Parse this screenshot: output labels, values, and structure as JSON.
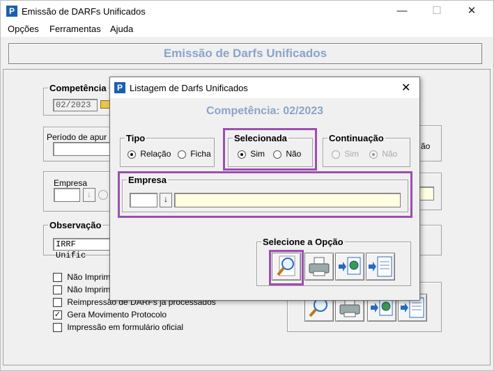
{
  "window": {
    "title": "Emissão de DARFs Unificados",
    "minimize": "—",
    "maximize": "☐",
    "close": "✕"
  },
  "menu": [
    "Opções",
    "Ferramentas",
    "Ajuda"
  ],
  "banner": "Emissão de Darfs Unificados",
  "main": {
    "competencia_label": "Competência",
    "competencia_value": "02/2023",
    "periodo_label": "Período de apur",
    "empresa_label": "Empresa",
    "observacao_label": "Observação",
    "observacao_value": "IRRF Unific",
    "right_fragment": "ão",
    "checks": [
      {
        "label": "Não Imprim",
        "checked": false
      },
      {
        "label": "Não Imprim",
        "checked": false
      },
      {
        "label": "Reimpressão de DARFs já processados",
        "checked": false
      },
      {
        "label": "Gera Movimento Protocolo",
        "checked": true
      },
      {
        "label": "Impressão em formulário oficial",
        "checked": false
      }
    ]
  },
  "dialog": {
    "title": "Listagem de Darfs Unificados",
    "close": "✕",
    "competencia": "Competência: 02/2023",
    "tipo": {
      "label": "Tipo",
      "opt1": "Relação",
      "opt2": "Ficha",
      "selected": "Relação"
    },
    "selecionada": {
      "label": "Selecionada",
      "opt1": "Sim",
      "opt2": "Não",
      "selected": "Sim"
    },
    "continuacao": {
      "label": "Continuação",
      "opt1": "Sim",
      "opt2": "Não",
      "selected": "Não"
    },
    "empresa": {
      "label": "Empresa",
      "code": "",
      "name": ""
    },
    "opcao": {
      "label": "Selecione a Opção"
    }
  },
  "colors": {
    "accent": "#9b4fb0",
    "banner_text": "#8aa4c8",
    "app_icon": "#1b5fb0"
  }
}
